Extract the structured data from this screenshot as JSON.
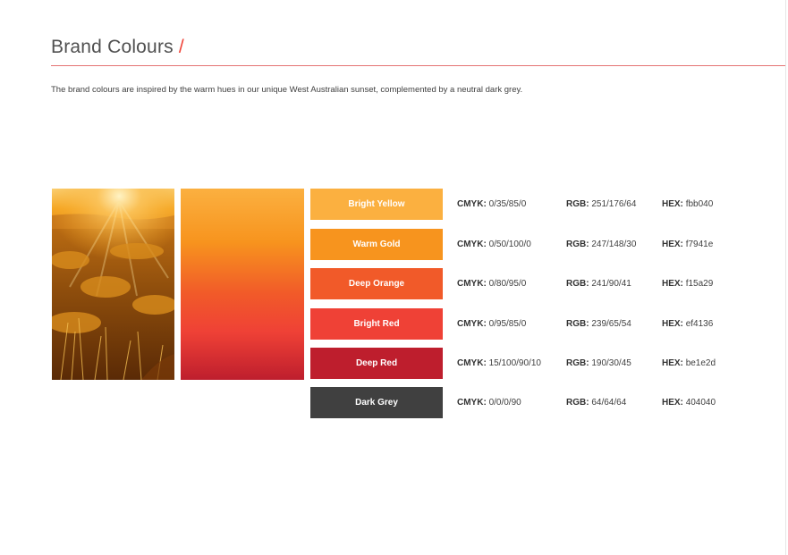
{
  "header": {
    "title": "Brand Colours",
    "slash": "/",
    "intro": "The brand colours are inspired by the warm hues in our unique West Australian sunset, complemented by a neutral dark grey."
  },
  "labels": {
    "cmyk": "CMYK:",
    "rgb": "RGB:",
    "hex": "HEX:"
  },
  "colours": [
    {
      "name": "Bright Yellow",
      "cmyk": "0/35/85/0",
      "rgb": "251/176/64",
      "hex": "fbb040",
      "swatch": "#fbb040"
    },
    {
      "name": "Warm Gold",
      "cmyk": "0/50/100/0",
      "rgb": "247/148/30",
      "hex": "f7941e",
      "swatch": "#f7941e"
    },
    {
      "name": "Deep Orange",
      "cmyk": "0/80/95/0",
      "rgb": "241/90/41",
      "hex": "f15a29",
      "swatch": "#f15a29"
    },
    {
      "name": "Bright Red",
      "cmyk": "0/95/85/0",
      "rgb": "239/65/54",
      "hex": "ef4136",
      "swatch": "#ef4136"
    },
    {
      "name": "Deep Red",
      "cmyk": "15/100/90/10",
      "rgb": "190/30/45",
      "hex": "be1e2d",
      "swatch": "#be1e2d"
    },
    {
      "name": "Dark Grey",
      "cmyk": "0/0/0/90",
      "rgb": "64/64/64",
      "hex": "404040",
      "swatch": "#404040"
    }
  ]
}
